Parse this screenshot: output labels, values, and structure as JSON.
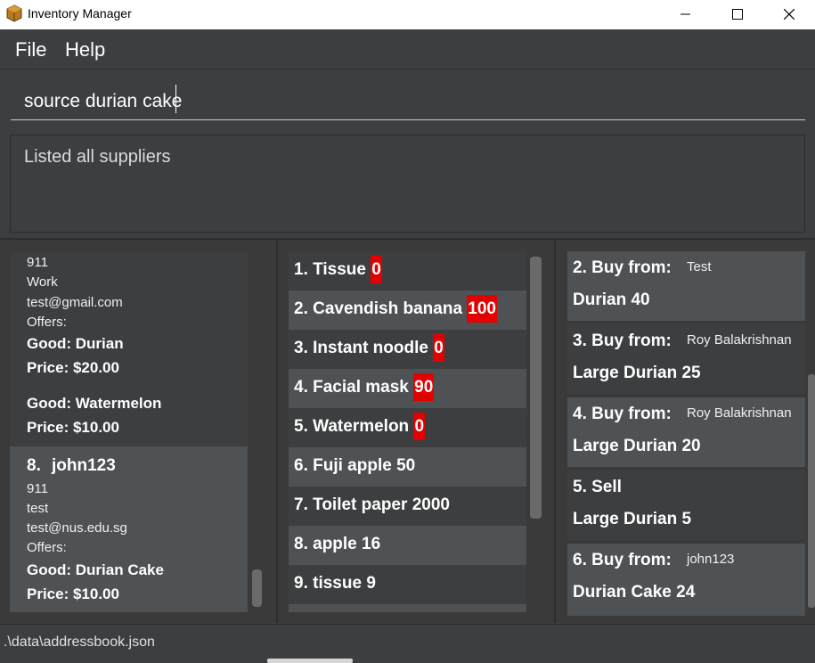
{
  "window": {
    "title": "Inventory Manager"
  },
  "menu": {
    "file": "File",
    "help": "Help"
  },
  "command": {
    "value": "source durian cake"
  },
  "result": {
    "message": "Listed all suppliers"
  },
  "suppliers": {
    "partial": {
      "phone": "911",
      "tag": "Work",
      "email": "test@gmail.com",
      "offers_label": "Offers:",
      "offers": [
        {
          "good": "Good: Durian",
          "price": "Price: $20.00"
        },
        {
          "good": "Good: Watermelon",
          "price": "Price: $10.00"
        }
      ]
    },
    "selected": {
      "index": "8.",
      "name": "john123",
      "phone": "911",
      "tag": "test",
      "email": "test@nus.edu.sg",
      "offers_label": "Offers:",
      "offers": [
        {
          "good": "Good: Durian Cake",
          "price": "Price: $10.00"
        }
      ]
    }
  },
  "inventory": [
    {
      "label": "1.  Tissue",
      "qty": "0",
      "alert": true
    },
    {
      "label": "2.  Cavendish banana",
      "qty": "100",
      "alert": true
    },
    {
      "label": "3.  Instant noodle",
      "qty": "0",
      "alert": true
    },
    {
      "label": "4.  Facial mask",
      "qty": "90",
      "alert": true
    },
    {
      "label": "5.  Watermelon",
      "qty": "0",
      "alert": true
    },
    {
      "label": "6.  Fuji apple",
      "qty": "50",
      "alert": false
    },
    {
      "label": "7.  Toilet paper",
      "qty": "2000",
      "alert": false
    },
    {
      "label": "8.  apple",
      "qty": "16",
      "alert": false
    },
    {
      "label": "9.  tissue",
      "qty": "9",
      "alert": false
    }
  ],
  "orders": [
    {
      "head": "2.  Buy from:",
      "vendor": "Test",
      "item": "Durian 40"
    },
    {
      "head": "3.  Buy from:",
      "vendor": "Roy Balakrishnan",
      "item": "Large Durian 25"
    },
    {
      "head": "4.  Buy from:",
      "vendor": "Roy Balakrishnan",
      "item": "Large Durian 20"
    },
    {
      "head": "5.  Sell",
      "vendor": "",
      "item": "Large Durian 5"
    },
    {
      "head": "6.  Buy from:",
      "vendor": "john123",
      "item": "Durian Cake 24"
    }
  ],
  "status": {
    "path": ".\\data\\addressbook.json"
  },
  "colors": {
    "alert": "#e30000",
    "background": "#3c3f41",
    "row_light": "#4e5254",
    "row_dark": "#3c3e40"
  },
  "icons": {
    "app": "treasure-box-icon",
    "minimize": "minimize-icon",
    "maximize": "maximize-icon",
    "close": "close-icon"
  }
}
